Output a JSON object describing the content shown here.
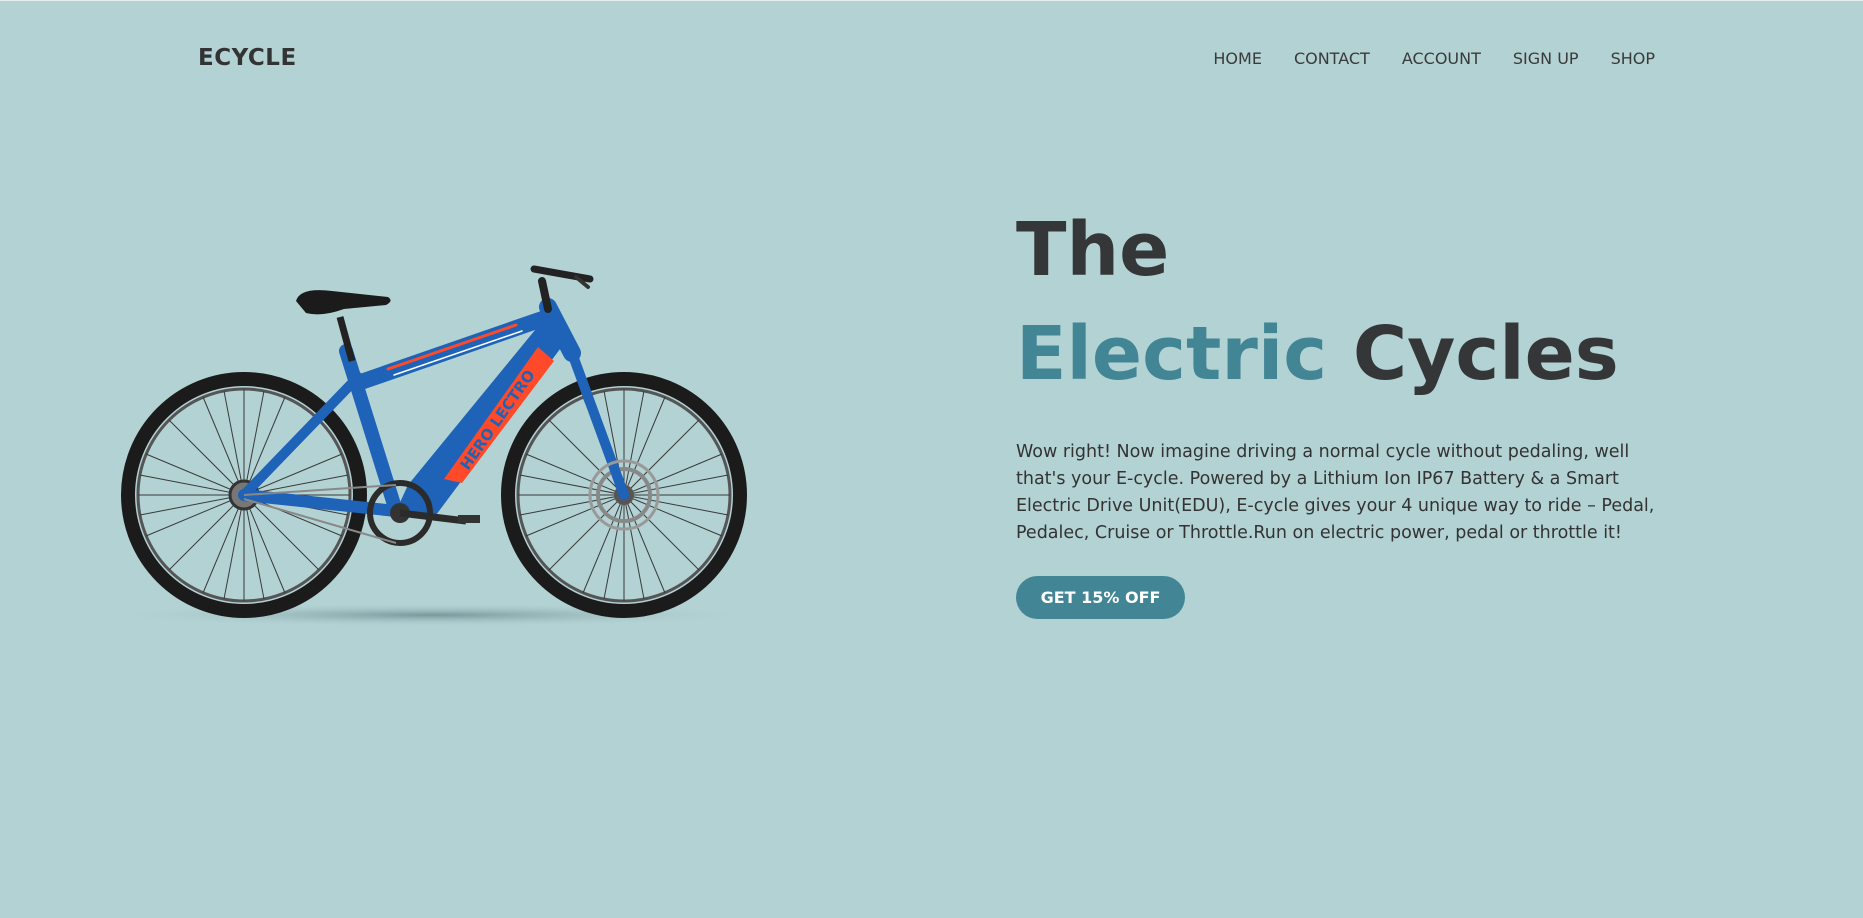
{
  "brand": {
    "logo": "ECYCLE"
  },
  "nav": {
    "items": [
      {
        "label": "HOME"
      },
      {
        "label": "CONTACT"
      },
      {
        "label": "ACCOUNT"
      },
      {
        "label": "SIGN UP"
      },
      {
        "label": "SHOP"
      }
    ]
  },
  "hero": {
    "title_line1": "The",
    "title_accent": "Electric",
    "title_rest": " Cycles",
    "description": "Wow right! Now imagine driving a normal cycle without pedaling, well that's your E-cycle. Powered by a Lithium Ion IP67 Battery & a Smart Electric Drive Unit(EDU), E-cycle gives your 4 unique way to ride – Pedal, Pedalec, Cruise or Throttle.Run on electric power, pedal or throttle it!",
    "cta_label": "GET 15% OFF",
    "image": {
      "icon": "electric-bicycle-image",
      "frame_decal": "HERO LECTRO"
    }
  },
  "colors": {
    "background": "#b3d2d4",
    "accent": "#428695",
    "text": "#333333",
    "frame_blue": "#1e63b8",
    "frame_decal": "#ff4a2a"
  }
}
